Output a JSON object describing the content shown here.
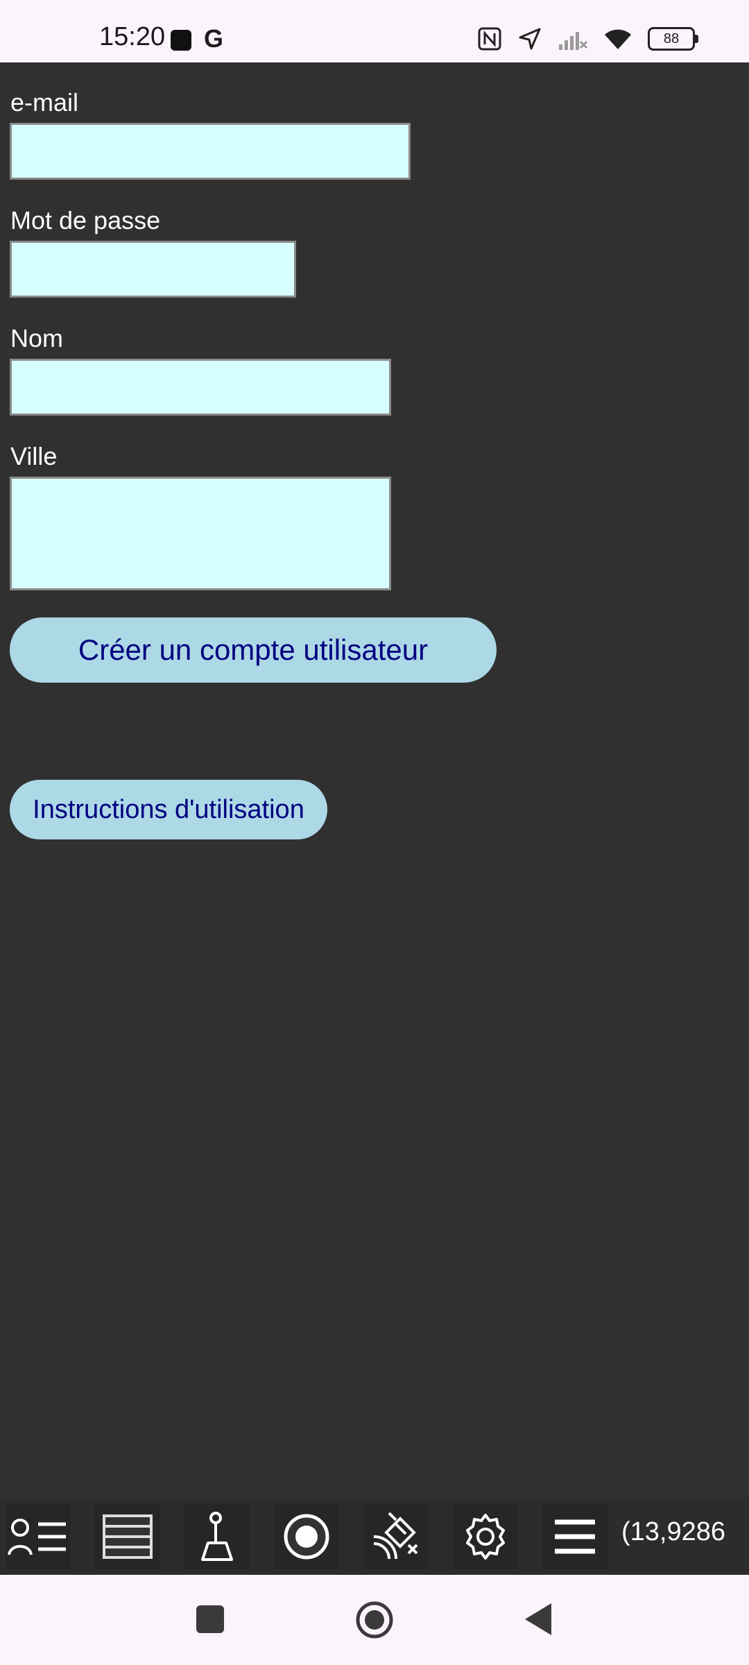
{
  "status_bar": {
    "time": "15:20",
    "g_label": "G",
    "battery": "88",
    "icons": [
      "nfc-icon",
      "location-arrow-icon",
      "signal-icon",
      "wifi-icon",
      "battery-icon"
    ]
  },
  "form": {
    "email_label": "e-mail",
    "email_value": "",
    "password_label": "Mot de passe",
    "password_value": "",
    "name_label": "Nom",
    "name_value": "",
    "city_label": "Ville",
    "city_value": "",
    "create_button": "Créer un compte utilisateur",
    "instructions_button": "Instructions d'utilisation"
  },
  "toolbar": {
    "icons": [
      "user-list-icon",
      "list-icon",
      "map-pin-icon",
      "record-icon",
      "satellite-icon",
      "gear-icon",
      "menu-icon"
    ],
    "coordinate": "(13,9286"
  },
  "colors": {
    "background": "#303030",
    "input_bg": "#d8ffff",
    "button_bg": "#add8e6",
    "button_text": "#000080"
  }
}
